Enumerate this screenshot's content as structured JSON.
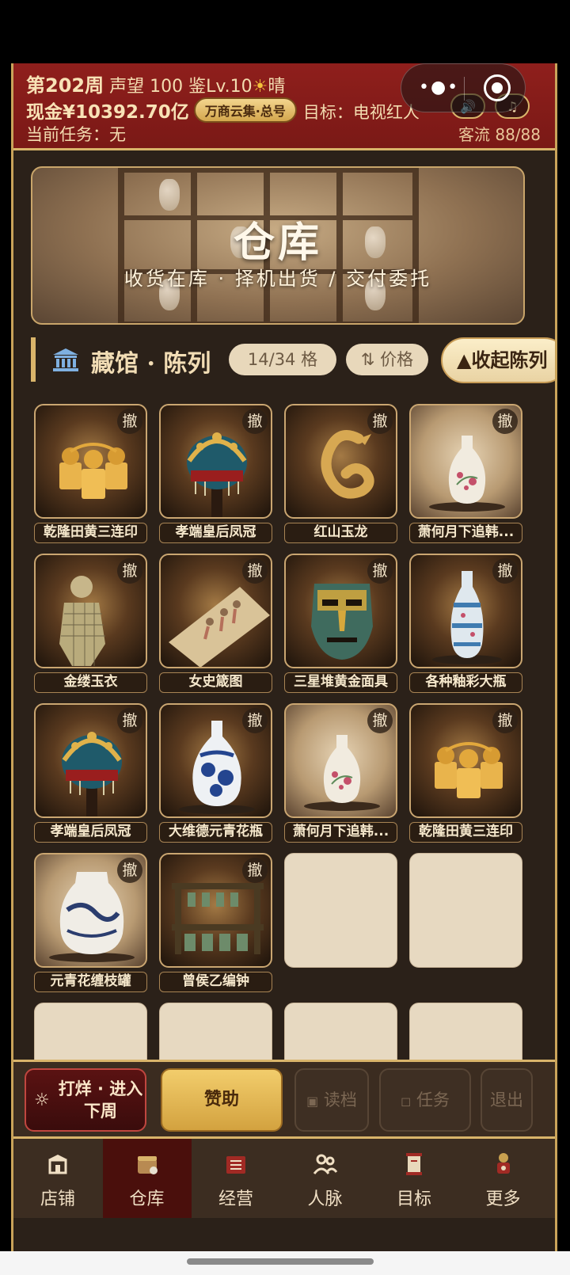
{
  "header": {
    "week": "第202周",
    "reputation": "声望 100",
    "appraisal": "鉴Lv.10",
    "weather_icon": "sun-icon",
    "weather": "晴",
    "cash": "现金¥10392.70亿",
    "shop_badge": "万商云集·总号",
    "goal": "目标：电视红人",
    "sound_icon": "speaker-icon",
    "music_icon": "music-note-icon",
    "task": "当前任务：无",
    "customer_flow": "客流 88/88"
  },
  "banner": {
    "title": "仓库",
    "subtitle": "收货在库 · 择机出货 / 交付委托"
  },
  "section": {
    "title": "藏馆 · 陈列",
    "capacity": "14/34 格",
    "sort": "⇅ 价格",
    "fold": "▲收起陈列"
  },
  "remove_label": "撤",
  "items": [
    {
      "name": "乾隆田黄三连印",
      "kind": "seal"
    },
    {
      "name": "孝端皇后凤冠",
      "kind": "crown"
    },
    {
      "name": "红山玉龙",
      "kind": "dragon"
    },
    {
      "name": "萧何月下追韩...",
      "kind": "vase",
      "light": true
    },
    {
      "name": "金缕玉衣",
      "kind": "suit"
    },
    {
      "name": "女史箴图",
      "kind": "scroll"
    },
    {
      "name": "三星堆黄金面具",
      "kind": "mask"
    },
    {
      "name": "各种釉彩大瓶",
      "kind": "vase2"
    },
    {
      "name": "孝端皇后凤冠",
      "kind": "crown"
    },
    {
      "name": "大维德元青花瓶",
      "kind": "bluevase"
    },
    {
      "name": "萧何月下追韩...",
      "kind": "vase",
      "light": true
    },
    {
      "name": "乾隆田黄三连印",
      "kind": "seal"
    },
    {
      "name": "元青花缠枝罐",
      "kind": "jar",
      "light": true
    },
    {
      "name": "曾侯乙编钟",
      "kind": "bells"
    }
  ],
  "actions": {
    "next_week": "打烊 · 进入下周",
    "sponsor": "赞助",
    "load": "读档",
    "task": "任务",
    "quit": "退出"
  },
  "tabs": [
    {
      "label": "店铺",
      "icon": "shop-icon"
    },
    {
      "label": "仓库",
      "icon": "warehouse-icon",
      "active": true
    },
    {
      "label": "经营",
      "icon": "ledger-icon"
    },
    {
      "label": "人脉",
      "icon": "people-icon"
    },
    {
      "label": "目标",
      "icon": "scroll-icon"
    },
    {
      "label": "更多",
      "icon": "more-icon"
    }
  ]
}
